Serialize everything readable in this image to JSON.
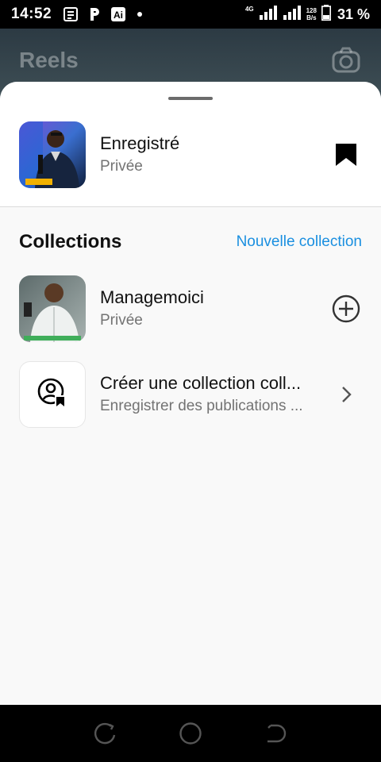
{
  "status_bar": {
    "time": "14:52",
    "network": "4G",
    "speed_value": "128",
    "speed_unit": "B/s",
    "battery": "31 %"
  },
  "background": {
    "title": "Reels"
  },
  "saved": {
    "title": "Enregistré",
    "subtitle": "Privée"
  },
  "collections": {
    "heading": "Collections",
    "new_label": "Nouvelle collection",
    "items": [
      {
        "title": "Managemoici",
        "subtitle": "Privée"
      }
    ],
    "create": {
      "title": "Créer une collection coll...",
      "subtitle": "Enregistrer des publications ..."
    }
  },
  "colors": {
    "accent": "#1a8fe0",
    "secondary_text": "#737373",
    "sheet_bg": "#f9f9f9"
  },
  "icons": {
    "status_left": [
      "notes-icon",
      "p-icon",
      "ai-icon"
    ],
    "saved_action": "bookmark-icon",
    "collection_action": "add-circle-icon",
    "create_icon": "collab-collection-icon",
    "create_action": "chevron-right-icon",
    "nav": [
      "recents-icon",
      "home-icon",
      "back-icon"
    ]
  }
}
